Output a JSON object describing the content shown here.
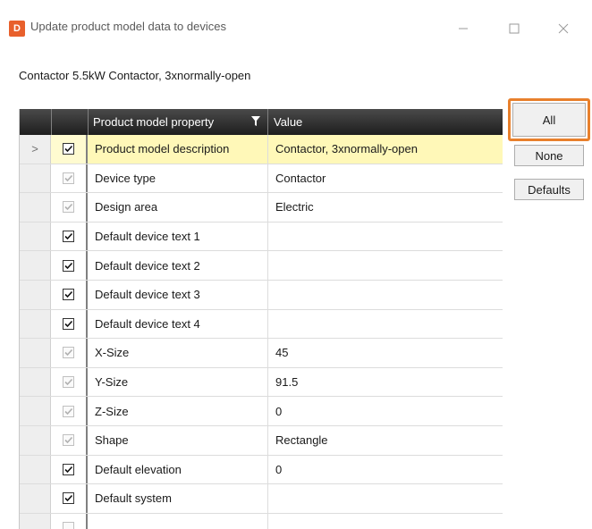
{
  "window": {
    "icon_letter": "D",
    "title": "Update product model data to devices",
    "subtitle": "Contactor 5.5kW Contactor, 3xnormally-open"
  },
  "grid": {
    "columns": [
      "Product model property",
      "Value"
    ],
    "rows": [
      {
        "indicator": ">",
        "checked": true,
        "disabled": false,
        "selected": true,
        "property": "Product model description",
        "value": "Contactor, 3xnormally-open"
      },
      {
        "indicator": "",
        "checked": true,
        "disabled": true,
        "selected": false,
        "property": "Device type",
        "value": "Contactor"
      },
      {
        "indicator": "",
        "checked": true,
        "disabled": true,
        "selected": false,
        "property": "Design area",
        "value": "Electric"
      },
      {
        "indicator": "",
        "checked": true,
        "disabled": false,
        "selected": false,
        "property": "Default device text 1",
        "value": ""
      },
      {
        "indicator": "",
        "checked": true,
        "disabled": false,
        "selected": false,
        "property": "Default device text 2",
        "value": ""
      },
      {
        "indicator": "",
        "checked": true,
        "disabled": false,
        "selected": false,
        "property": "Default device text 3",
        "value": ""
      },
      {
        "indicator": "",
        "checked": true,
        "disabled": false,
        "selected": false,
        "property": "Default device text 4",
        "value": ""
      },
      {
        "indicator": "",
        "checked": true,
        "disabled": true,
        "selected": false,
        "property": "X-Size",
        "value": "45"
      },
      {
        "indicator": "",
        "checked": true,
        "disabled": true,
        "selected": false,
        "property": "Y-Size",
        "value": "91.5"
      },
      {
        "indicator": "",
        "checked": true,
        "disabled": true,
        "selected": false,
        "property": "Z-Size",
        "value": "0"
      },
      {
        "indicator": "",
        "checked": true,
        "disabled": true,
        "selected": false,
        "property": "Shape",
        "value": "Rectangle"
      },
      {
        "indicator": "",
        "checked": true,
        "disabled": false,
        "selected": false,
        "property": "Default elevation",
        "value": "0"
      },
      {
        "indicator": "",
        "checked": true,
        "disabled": false,
        "selected": false,
        "property": "Default system",
        "value": ""
      },
      {
        "indicator": "",
        "checked": false,
        "disabled": true,
        "selected": false,
        "property": "",
        "value": ""
      }
    ]
  },
  "buttons": {
    "all": "All",
    "none": "None",
    "defaults": "Defaults"
  },
  "colors": {
    "accent": "#e8802c",
    "app_icon": "#e8602c",
    "selected_row": "#fff8b8",
    "header_bg": "#2a2a2a"
  }
}
